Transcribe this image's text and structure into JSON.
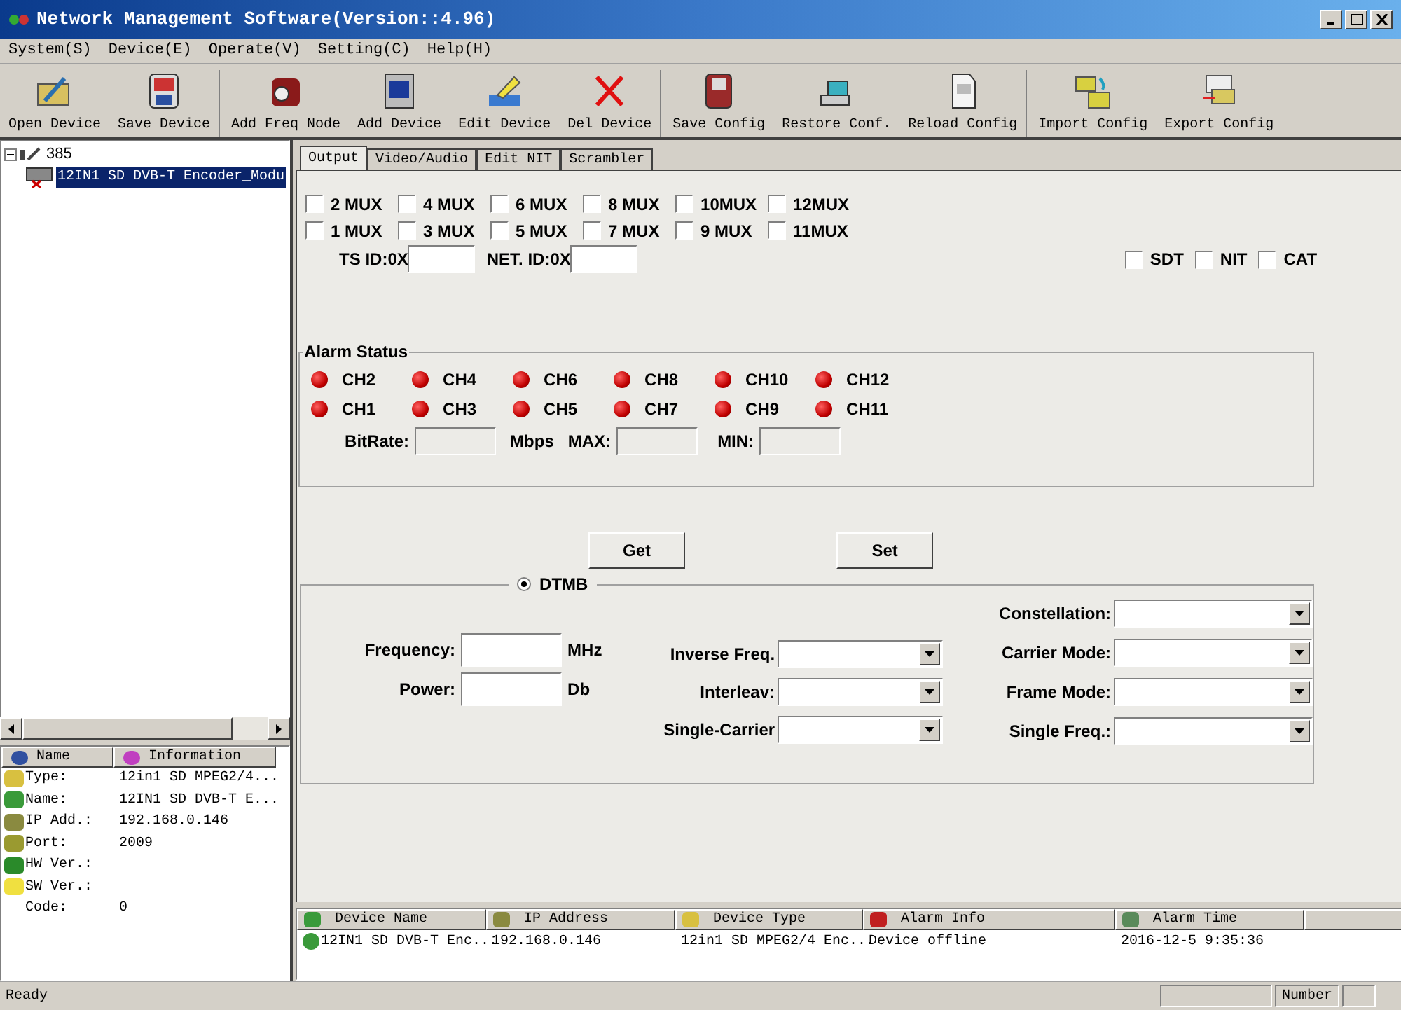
{
  "window": {
    "title": "Network Management Software(Version::4.96)"
  },
  "menu": [
    "System(S)",
    "Device(E)",
    "Operate(V)",
    "Setting(C)",
    "Help(H)"
  ],
  "toolbar": [
    [
      {
        "label": "Open Device"
      },
      {
        "label": "Save Device"
      }
    ],
    [
      {
        "label": "Add Freq Node"
      },
      {
        "label": "Add Device"
      },
      {
        "label": "Edit Device"
      },
      {
        "label": "Del Device"
      }
    ],
    [
      {
        "label": "Save Config"
      },
      {
        "label": "Restore Conf."
      },
      {
        "label": "Reload Config"
      }
    ],
    [
      {
        "label": "Import Config"
      },
      {
        "label": "Export Config"
      }
    ]
  ],
  "tree": [
    {
      "label": "385",
      "expanded": true,
      "selected": false,
      "children": [
        {
          "label": "12IN1 SD DVB-T Encoder_Modu",
          "selected": true
        }
      ]
    }
  ],
  "properties": {
    "columns": [
      "Name",
      "Information"
    ],
    "rows": [
      {
        "name": "Type:",
        "value": "12in1 SD MPEG2/4..."
      },
      {
        "name": "Name:",
        "value": "12IN1 SD DVB-T E..."
      },
      {
        "name": "IP Add.:",
        "value": "192.168.0.146"
      },
      {
        "name": "Port:",
        "value": "2009"
      },
      {
        "name": "HW Ver.:"
      },
      {
        "name": "SW Ver.:"
      },
      {
        "name": "Code:",
        "value": "0"
      }
    ]
  },
  "tabs": [
    {
      "label": "Output",
      "selected": true
    },
    {
      "label": "Video/Audio",
      "selected": false
    },
    {
      "label": "Edit NIT",
      "selected": false
    },
    {
      "label": "Scrambler",
      "selected": false
    }
  ],
  "mux_rows": [
    [
      {
        "label": "2 MUX",
        "checked": false
      },
      {
        "label": "4 MUX",
        "checked": false
      },
      {
        "label": "6 MUX",
        "checked": false
      },
      {
        "label": "8 MUX",
        "checked": false
      },
      {
        "label": "10MUX",
        "checked": false
      },
      {
        "label": "12MUX",
        "checked": false
      }
    ],
    [
      {
        "label": "1 MUX",
        "checked": false
      },
      {
        "label": "3 MUX",
        "checked": false
      },
      {
        "label": "5 MUX",
        "checked": false
      },
      {
        "label": "7 MUX",
        "checked": false
      },
      {
        "label": "9 MUX",
        "checked": false
      },
      {
        "label": "11MUX",
        "checked": false
      }
    ]
  ],
  "ts_id": {
    "label": "TS ID:0X"
  },
  "net_id": {
    "label": "NET. ID:0X"
  },
  "tables": [
    {
      "label": "SDT",
      "checked": false
    },
    {
      "label": "NIT",
      "checked": false
    },
    {
      "label": "CAT",
      "checked": false
    }
  ],
  "alarm_status": {
    "title": "Alarm Status",
    "rows": [
      [
        {
          "label": "CH2",
          "alarm": true
        },
        {
          "label": "CH4",
          "alarm": true
        },
        {
          "label": "CH6",
          "alarm": true
        },
        {
          "label": "CH8",
          "alarm": true
        },
        {
          "label": "CH10",
          "alarm": true
        },
        {
          "label": "CH12",
          "alarm": true
        }
      ],
      [
        {
          "label": "CH1",
          "alarm": true
        },
        {
          "label": "CH3",
          "alarm": true
        },
        {
          "label": "CH5",
          "alarm": true
        },
        {
          "label": "CH7",
          "alarm": true
        },
        {
          "label": "CH9",
          "alarm": true
        },
        {
          "label": "CH11",
          "alarm": true
        }
      ]
    ],
    "bitrate_label": "BitRate:",
    "unit": "Mbps",
    "max_label": "MAX:",
    "min_label": "MIN:"
  },
  "buttons": [
    "Get",
    "Set"
  ],
  "dtmb": {
    "label": "DTMB",
    "selected": true,
    "frequency": {
      "label": "Frequency:",
      "unit": "MHz"
    },
    "power": {
      "label": "Power:",
      "unit": "Db"
    },
    "middle": [
      "Inverse Freq.",
      "Interleav:",
      "Single-Carrier"
    ],
    "right": [
      "Constellation:",
      "Carrier Mode:",
      "Frame Mode:",
      "Single Freq.:"
    ]
  },
  "device_list": {
    "columns": [
      "Device Name",
      "IP Address",
      "Device Type",
      "Alarm Info",
      "Alarm Time"
    ],
    "rows": [
      [
        "12IN1 SD DVB-T Enc...",
        "192.168.0.146",
        "12in1 SD MPEG2/4 Enc...",
        "Device offline",
        "2016-12-5 9:35:36"
      ]
    ]
  },
  "status_bar": {
    "text": "Ready",
    "panels": [
      "Number"
    ]
  }
}
